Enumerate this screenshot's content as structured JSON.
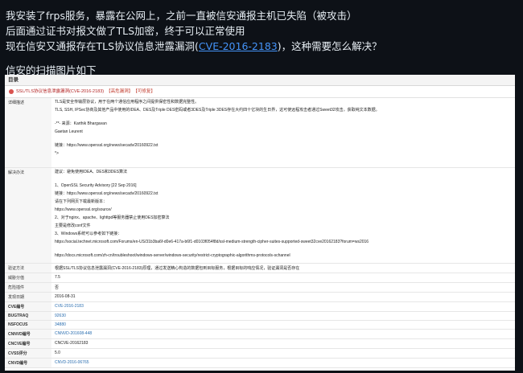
{
  "post": {
    "line1": "我安装了frps服务，暴露在公网上，之前一直被信安通报主机已失陷（被攻击）",
    "line2": "后面通过证书对报文做了TLS加密，终于可以正常使用",
    "line3_prefix": "现在信安又通报存在TLS协议信息泄露漏洞(",
    "line3_link": "CVE-2016-2183",
    "line3_suffix": ")，这种需要怎么解决？",
    "caption": "信安的扫描图片如下"
  },
  "report": {
    "header": "目录",
    "vuln_title": "SSL/TLS协议信息泄露漏洞(CVE-2016-2183)",
    "tag1": "【高危漏洞】",
    "tag2": "【可修复】",
    "desc_label": "详细描述",
    "desc_lines": [
      "TLS是安全传输层协议，用于在两个通信应用程序之间提供保密性和数据完整性。",
      "TLS, SSH, IPSec协商及其他产品中使用的IDEA、DES及Triple DES密码或者3DES及Triple 3DES存在大约四十亿块的生日界，这可使远程攻击者通过Sweet32攻击，获取纯文本数据。",
      "",
      "-**- 来源：Karthik Bhargavan",
      "Gaetan Leurent",
      "",
      "链接：https://www.openssl.org/news/secadv/20160922.txt",
      "*>"
    ],
    "sol_label": "解决办法",
    "sol_lines": [
      "建议：避免使用IDEA、DES和3DES算法",
      "",
      "1、OpenSSL Security Advisory [22 Sep 2016]",
      "链接：https://www.openssl.org/news/secadv/20160922.txt",
      "请在下列网页下载最新版本：",
      "https://www.openssl.org/source/",
      "2、对于nginx、apache、lighttpd等服务器禁止使用DES加密算法",
      "主要是修改conf文件",
      "3、Windows系统可以参考如下链接：",
      "https://social.technet.microsoft.com/Forums/en-US/31b3ba6f-d0e6-417a-b6f1-d0103f054f8d/ssl-medium-strength-cipher-suites-supported-sweet32cve20162183?forum=ws2016",
      "",
      "https://docs.microsoft.com/zh-cn/troubleshoot/windows-server/windows-security/restrict-cryptographic-algorithms-protocols-schannel"
    ],
    "rows": [
      {
        "k": "威胁分值",
        "v": "7.5",
        "bold": false,
        "link": false
      },
      {
        "k": "危险插件",
        "v": "否",
        "bold": false,
        "link": false
      },
      {
        "k": "发现日期",
        "v": "2016-08-31",
        "bold": false,
        "link": false
      },
      {
        "k": "CVE编号",
        "v": "CVE-2016-2183",
        "bold": true,
        "link": true
      },
      {
        "k": "BUGTRAQ",
        "v": "92630",
        "bold": true,
        "link": true
      },
      {
        "k": "NSFOCUS",
        "v": "34880",
        "bold": true,
        "link": true
      },
      {
        "k": "CNNVD编号",
        "v": "CNNVD-201608-448",
        "bold": true,
        "link": true
      },
      {
        "k": "CNCVE编号",
        "v": "CNCVE-20162183",
        "bold": true,
        "link": false
      },
      {
        "k": "CVSS评分",
        "v": "5.0",
        "bold": true,
        "link": false
      },
      {
        "k": "CNVD编号",
        "v": "CNVD-2016-06765",
        "bold": true,
        "link": true
      }
    ],
    "verify_label": "验证方法",
    "verify_text": "根据SSL/TLS协议信息泄露漏洞(CVE-2016-2183)原理，通过发送精心构造的数据包到目标服务，根据目标的响应情况，验证漏洞是否存在"
  }
}
